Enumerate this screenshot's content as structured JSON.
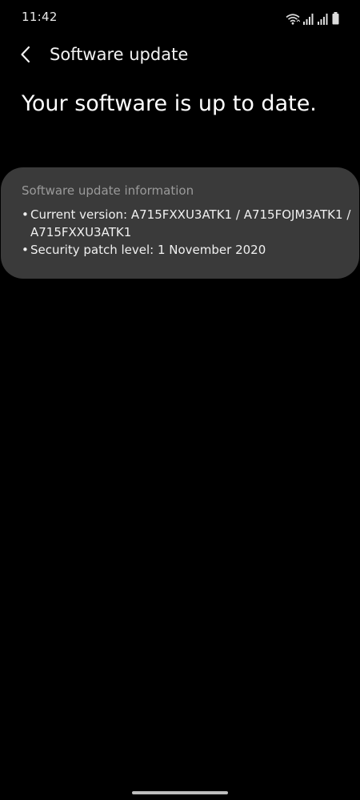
{
  "status_bar": {
    "time": "11:42",
    "icons": [
      "wifi-icon",
      "signal-sim1-icon",
      "signal-sim2-icon",
      "battery-icon"
    ]
  },
  "app_bar": {
    "title": "Software update",
    "back_icon": "chevron-left-icon"
  },
  "headline": "Your software is up to date.",
  "info_card": {
    "title": "Software update information",
    "items": [
      {
        "line1": "Current version: A715FXXU3ATK1 / A715FOJM3ATK1 /",
        "line2": "A715FXXU3ATK1"
      },
      {
        "line1": "Security patch level: 1 November 2020"
      }
    ]
  },
  "colors": {
    "background": "#000000",
    "card": "#3a3a3a",
    "card_title": "#9a9a9a",
    "text": "#ffffff"
  }
}
